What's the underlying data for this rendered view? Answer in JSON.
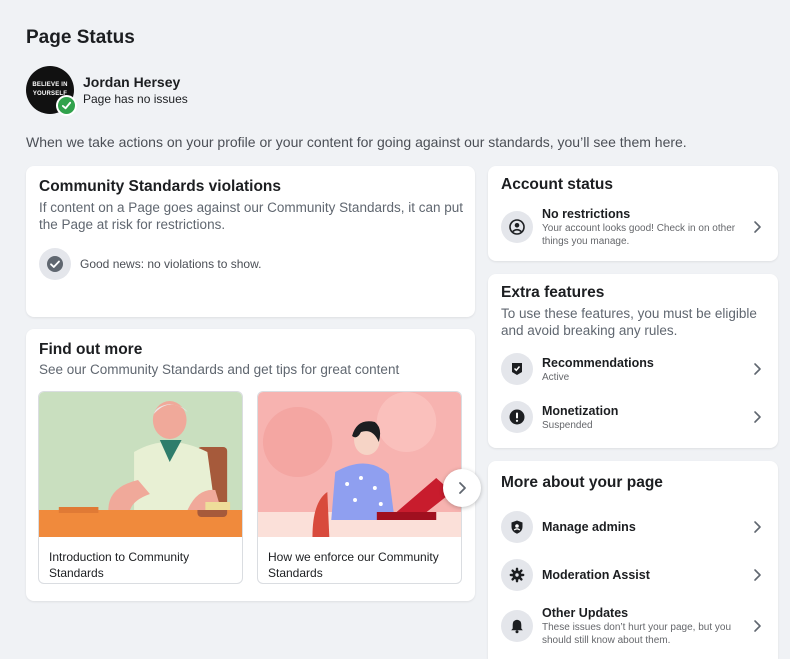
{
  "page": {
    "title": "Page Status"
  },
  "profile": {
    "name": "Jordan Hersey",
    "status": "Page has no issues",
    "avatar_text_1": "BELIEVE IN",
    "avatar_text_2": "YOURSELF"
  },
  "intro": "When we take actions on your profile or your content for going against our standards, you’ll see them here.",
  "violations": {
    "title": "Community Standards violations",
    "description": "If content on a Page goes against our Community Standards, it can put the Page at risk for restrictions.",
    "good_news": "Good news: no violations to show."
  },
  "find_out_more": {
    "title": "Find out more",
    "description": "See our Community Standards and get tips for great content",
    "tiles": [
      {
        "label": "Introduction to Community Standards"
      },
      {
        "label": "How we enforce our Community Standards"
      }
    ]
  },
  "account_status": {
    "title": "Account status",
    "item": {
      "title": "No restrictions",
      "subtitle": "Your account looks good! Check in on other things you manage.",
      "icon": "user-circle-icon"
    }
  },
  "extra_features": {
    "title": "Extra features",
    "description": "To use these features, you must be eligible and avoid breaking any rules.",
    "items": [
      {
        "title": "Recommendations",
        "subtitle": "Active",
        "icon": "recommendations-icon"
      },
      {
        "title": "Monetization",
        "subtitle": "Suspended",
        "icon": "alert-icon"
      }
    ]
  },
  "more_about": {
    "title": "More about your page",
    "items": [
      {
        "title": "Manage admins",
        "icon": "shield-icon"
      },
      {
        "title": "Moderation Assist",
        "icon": "gear-icon"
      },
      {
        "title": "Other Updates",
        "subtitle": "These issues don’t hurt your page, but you should still know about them.",
        "icon": "bell-icon"
      }
    ]
  },
  "colors": {
    "background": "#f0f2f5",
    "card": "#ffffff",
    "verified": "#31a24c",
    "icon_bg": "#e4e6eb"
  }
}
